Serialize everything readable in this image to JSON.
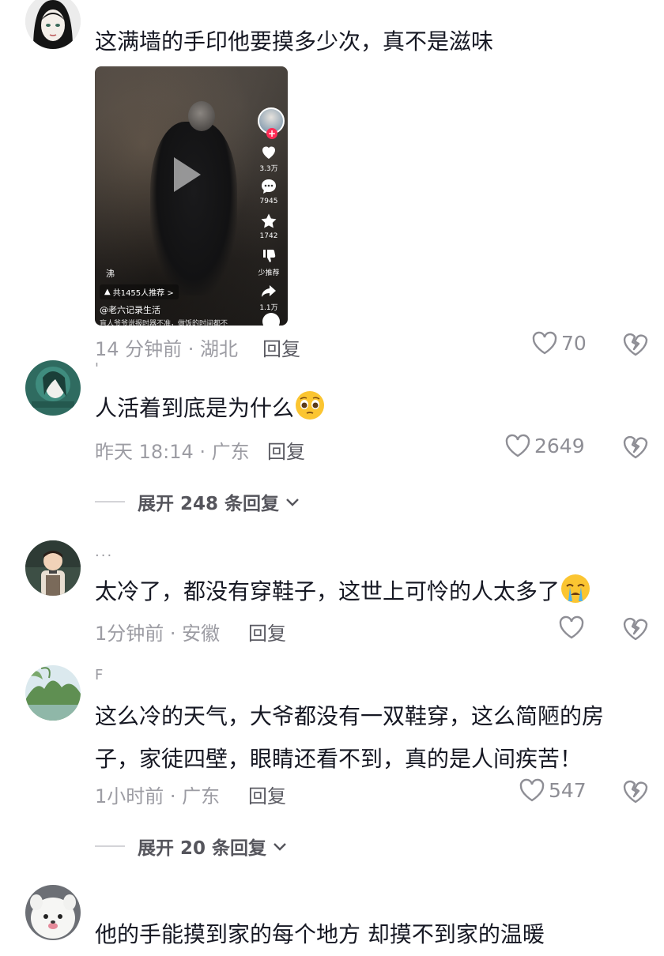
{
  "comments": [
    {
      "username": "",
      "text": "这满墙的手印他要摸多少次，真不是滋味",
      "meta": "14 分钟前 · 湖北",
      "reply": "回复",
      "likes": "70"
    },
    {
      "username": "'",
      "text": "人活着到底是为什么",
      "emoji": "pleading-face",
      "meta": "昨天 18:14 · 广东",
      "reply": "回复",
      "likes": "2649",
      "expand": "展开 248 条回复"
    },
    {
      "username": "...",
      "text": "太冷了，都没有穿鞋子，这世上可怜的人太多了",
      "emoji": "crying-face",
      "meta": "1分钟前 · 安徽",
      "reply": "回复",
      "likes": ""
    },
    {
      "username": "F",
      "text": "这么冷的天气，大爷都没有一双鞋穿，这么简陋的房子，家徒四壁，眼睛还看不到，真的是人间疾苦！",
      "meta": "1小时前 · 广东",
      "reply": "回复",
      "likes": "547",
      "expand": "展开 20 条回复"
    },
    {
      "username": "",
      "text": "他的手能摸到家的每个地方 却摸不到家的温暖"
    }
  ],
  "video": {
    "likes": "3.3万",
    "comments": "7945",
    "favorites": "1742",
    "dislike_label": "少推荐",
    "shares": "1.1万",
    "recommend_tag": "共1455人推荐 >",
    "author": "@老六记录生活",
    "small_text": "沸",
    "desc": "盲人爷爷说报时器不准，做饭的时间都不"
  },
  "colors": {
    "accent": "#fe2c55",
    "text_primary": "#161823",
    "text_secondary": "#9c9ca3"
  }
}
